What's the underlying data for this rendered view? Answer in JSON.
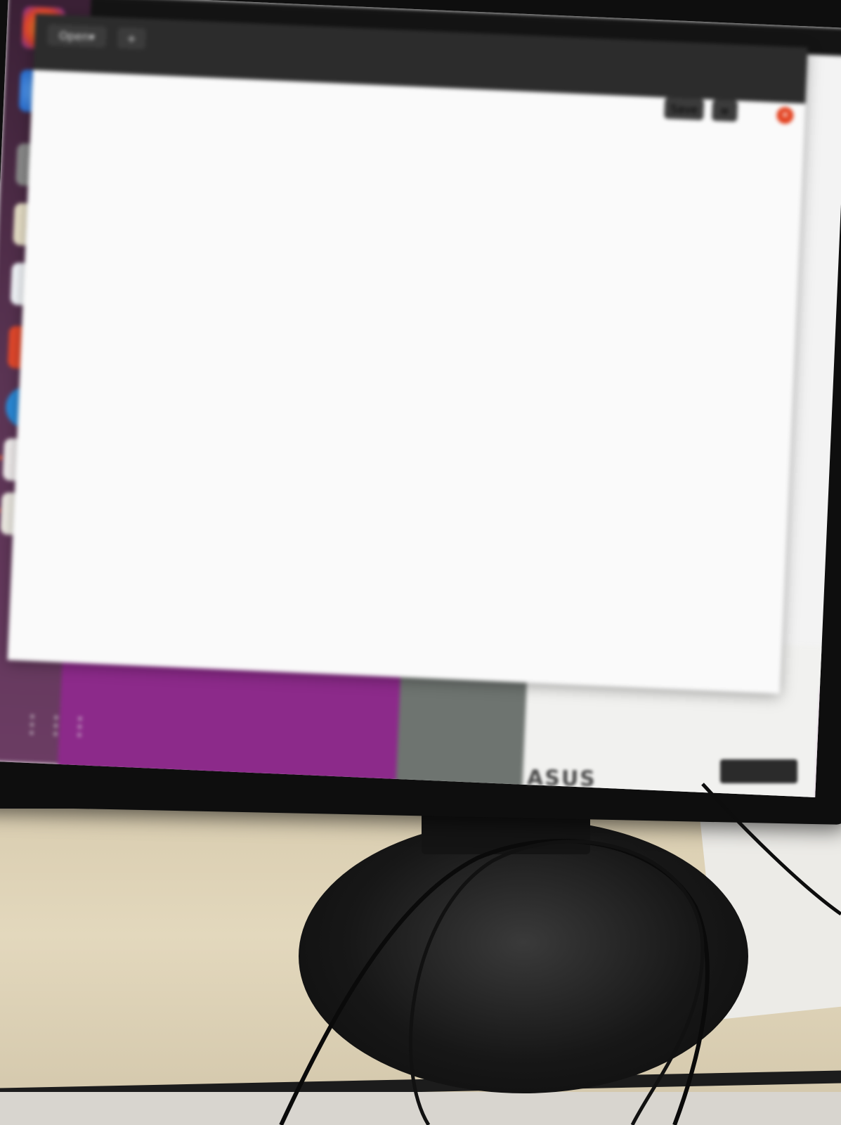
{
  "editor": {
    "open_label": "Open",
    "new_tab_label": "+",
    "title": "",
    "subtitle": "",
    "save_label": "Save",
    "menu_icon": "hamburger-menu-icon",
    "close_icon": "close-icon",
    "code_lines": [
      "",
      "",
      "",
      "",
      "",
      "",
      "",
      "",
      "",
      "",
      "",
      "",
      "",
      "",
      "",
      "",
      "",
      "",
      "",
      "",
      "",
      "",
      "",
      "",
      "",
      "",
      ""
    ],
    "status": {
      "language": "",
      "tab_width": "",
      "cursor": "",
      "mode": ""
    }
  },
  "monitor": {
    "brand": "ASUS"
  },
  "colors": {
    "dock_top": "#3a2035",
    "dock_bottom": "#6b3c63",
    "wallpaper_magenta": "#8c2a8a",
    "close_button": "#e3411f"
  },
  "dock_icons": [
    "firefox-icon",
    "thunderbird-icon",
    "files-icon",
    "rhythmbox-icon",
    "libreoffice-writer-icon",
    "software-center-icon",
    "help-icon",
    "pdf-viewer-icon",
    "text-editor-icon",
    "show-applications-icon"
  ]
}
